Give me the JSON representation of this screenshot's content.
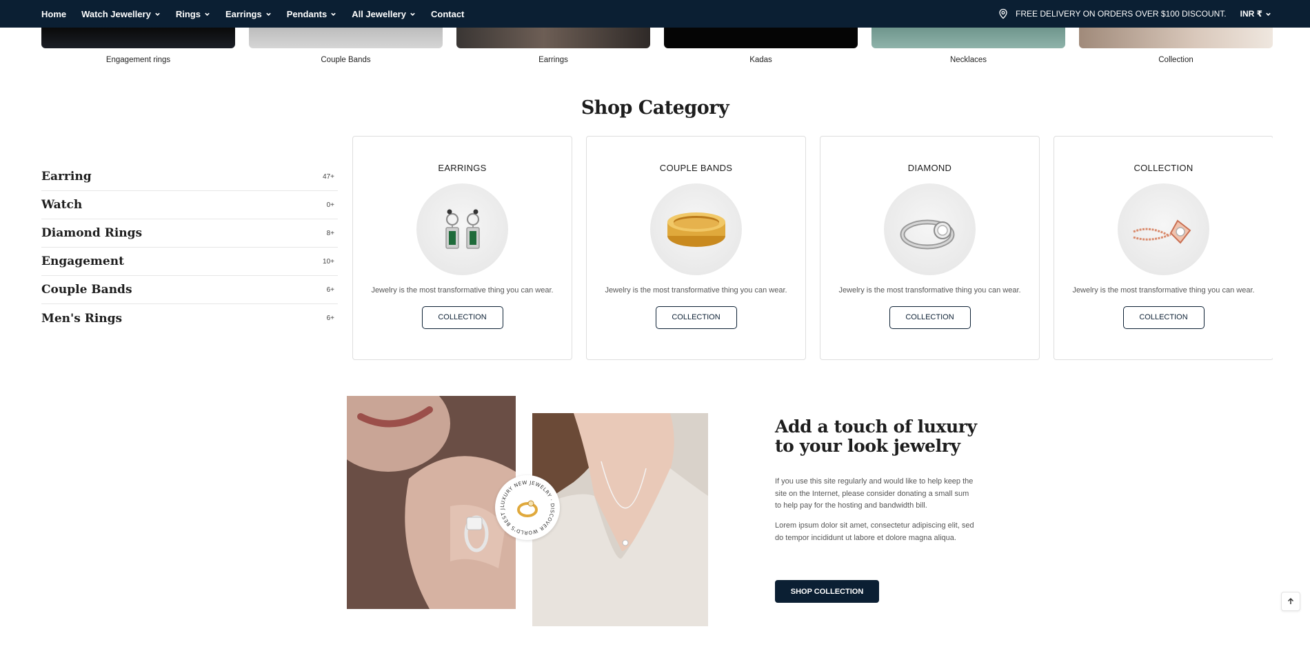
{
  "nav": {
    "items": [
      {
        "label": "Home",
        "dropdown": false
      },
      {
        "label": "Watch Jewellery",
        "dropdown": true
      },
      {
        "label": "Rings",
        "dropdown": true
      },
      {
        "label": "Earrings",
        "dropdown": true
      },
      {
        "label": "Pendants",
        "dropdown": true
      },
      {
        "label": "All Jewellery",
        "dropdown": true
      },
      {
        "label": "Contact",
        "dropdown": false
      }
    ],
    "delivery_text": "FREE DELIVERY ON ORDERS OVER $100 DISCOUNT.",
    "currency": "INR ₹"
  },
  "top_categories": [
    {
      "label": "Engagement rings"
    },
    {
      "label": "Couple Bands"
    },
    {
      "label": "Earrings"
    },
    {
      "label": "Kadas"
    },
    {
      "label": "Necklaces"
    },
    {
      "label": "Collection"
    }
  ],
  "shop_category": {
    "title": "Shop Category",
    "list": [
      {
        "name": "Earring",
        "count": "47+"
      },
      {
        "name": "Watch",
        "count": "0+"
      },
      {
        "name": "Diamond Rings",
        "count": "8+"
      },
      {
        "name": "Engagement",
        "count": "10+"
      },
      {
        "name": "Couple Bands",
        "count": "6+"
      },
      {
        "name": "Men's Rings",
        "count": "6+"
      }
    ],
    "cards": [
      {
        "title": "EARRINGS",
        "description": "Jewelry is the most transformative thing you can wear.",
        "button": "COLLECTION",
        "icon": "earrings-icon"
      },
      {
        "title": "COUPLE BANDS",
        "description": "Jewelry is the most transformative thing you can wear.",
        "button": "COLLECTION",
        "icon": "gold-band-icon"
      },
      {
        "title": "DIAMOND",
        "description": "Jewelry is the most transformative thing you can wear.",
        "button": "COLLECTION",
        "icon": "diamond-ring-icon"
      },
      {
        "title": "COLLECTION",
        "description": "Jewelry is the most transformative thing you can wear.",
        "button": "COLLECTION",
        "icon": "rose-gold-pendant-icon"
      }
    ]
  },
  "luxury": {
    "title_line1": "Add a touch of luxury",
    "title_line2": "to your look jewelry",
    "paragraph1": "If you use this site regularly and would like to help keep the site on the Internet, please consider donating a small sum to help pay for the hosting and bandwidth bill.",
    "paragraph2": "Lorem ipsum dolor sit amet, consectetur adipiscing elit, sed do tempor incididunt ut labore et dolore magna aliqua.",
    "button": "SHOP COLLECTION",
    "badge_text": "LUXURY NEW JEWELRY · DISCOVER WORLD'S BEST JEWELRY ·"
  },
  "colors": {
    "navy": "#0b1f33",
    "gold": "#e0a93c",
    "rose_gold": "#d98a6c"
  }
}
